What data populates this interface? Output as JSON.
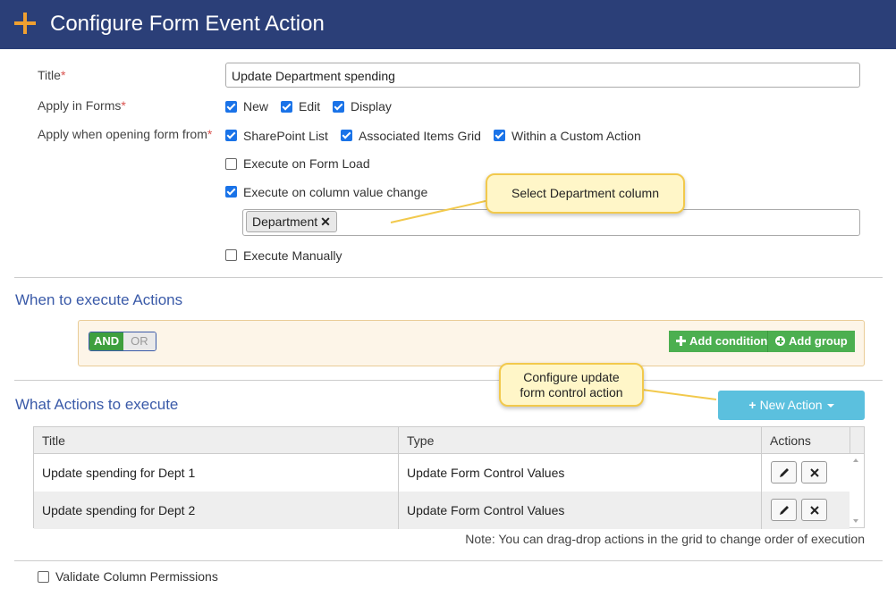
{
  "header": {
    "title": "Configure Form Event Action"
  },
  "form": {
    "title_label": "Title",
    "required_mark": "*",
    "title_value": "Update Department spending",
    "apply_in_forms_label": "Apply in Forms",
    "forms": [
      {
        "label": "New",
        "checked": true
      },
      {
        "label": "Edit",
        "checked": true
      },
      {
        "label": "Display",
        "checked": true
      }
    ],
    "apply_when_label": "Apply when opening form from",
    "sources": [
      {
        "label": "SharePoint List",
        "checked": true
      },
      {
        "label": "Associated Items Grid",
        "checked": true
      },
      {
        "label": "Within a Custom Action",
        "checked": true
      }
    ],
    "execute_on_load": {
      "label": "Execute on Form Load",
      "checked": false
    },
    "execute_on_change": {
      "label": "Execute on column value change",
      "checked": true
    },
    "selected_columns": [
      {
        "label": "Department",
        "remove": "✕"
      }
    ],
    "execute_manually": {
      "label": "Execute Manually",
      "checked": false
    }
  },
  "callouts": {
    "select_column": "Select Department column",
    "configure_line1": "Configure update",
    "configure_line2": "form control action"
  },
  "when_section": {
    "title": "When to execute Actions",
    "and_label": "AND",
    "or_label": "OR",
    "add_condition": "Add condition",
    "add_group": "Add group"
  },
  "actions_section": {
    "title": "What Actions to execute",
    "new_action": "New Action",
    "columns": [
      "Title",
      "Type",
      "Actions"
    ],
    "rows": [
      {
        "title": "Update spending for Dept 1",
        "type": "Update Form Control Values"
      },
      {
        "title": "Update spending for Dept 2",
        "type": "Update Form Control Values"
      }
    ],
    "note": "Note: You can drag-drop actions in the grid to change order of execution"
  },
  "footer": {
    "validate": {
      "label": "Validate Column Permissions",
      "checked": false
    }
  },
  "colors": {
    "header_bg": "#2b3f78",
    "accent_plus": "#f0a030",
    "section_title": "#3a5aa8",
    "green_btn": "#4caf50",
    "info_btn": "#5bc0de"
  }
}
